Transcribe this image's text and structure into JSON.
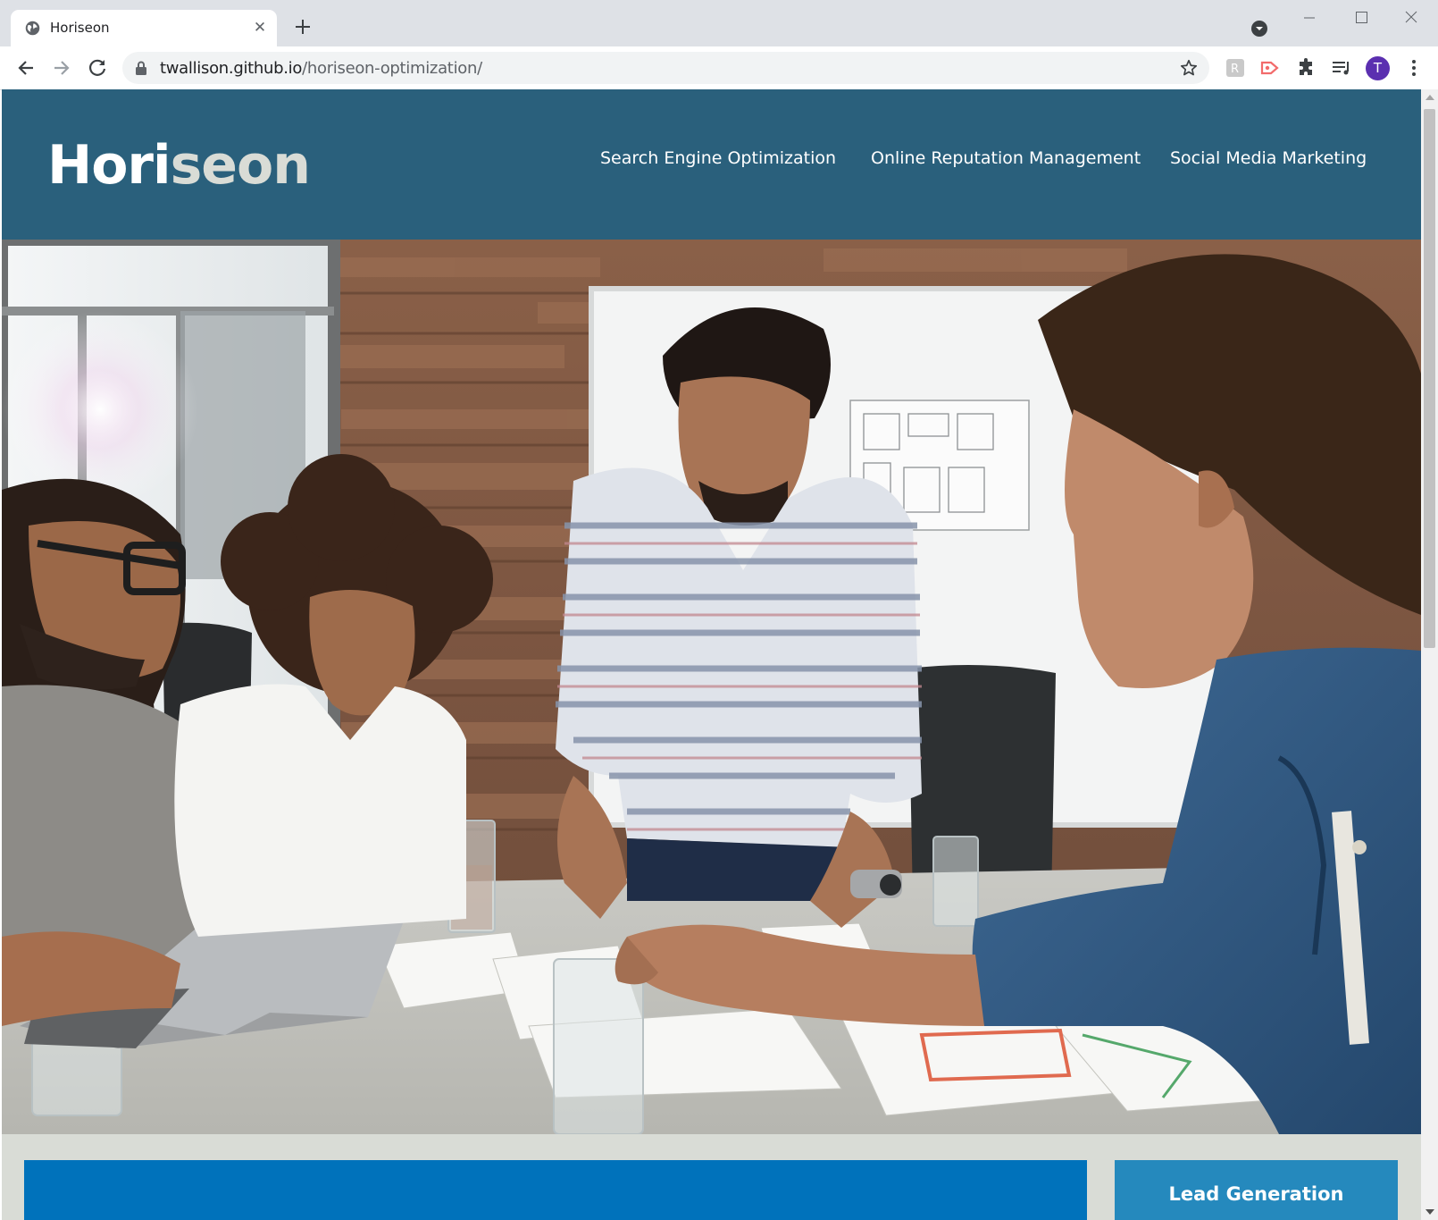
{
  "browser": {
    "tab": {
      "title": "Horiseon",
      "close_icon": "close-icon"
    },
    "address": {
      "host": "twallison.github.io",
      "path": "/horiseon-optimization/"
    },
    "avatar_letter": "T"
  },
  "site": {
    "logo": {
      "part1": "Hori",
      "part2": "seon"
    },
    "nav": [
      {
        "label": "Search Engine Optimization"
      },
      {
        "label": "Online Reputation Management"
      },
      {
        "label": "Social Media Marketing"
      }
    ],
    "hero": {
      "alt": "a group of people sitting at a table reviewing documents",
      "description_icon": "hero-image"
    },
    "benefits": [
      {
        "title": "Lead Generation"
      }
    ]
  },
  "colors": {
    "header_bg": "#2a607c",
    "page_bg": "#d9dcd6",
    "content_bg": "#0072bb",
    "benefit_bg": "#2589bd",
    "avatar": "#5b2fb0"
  }
}
